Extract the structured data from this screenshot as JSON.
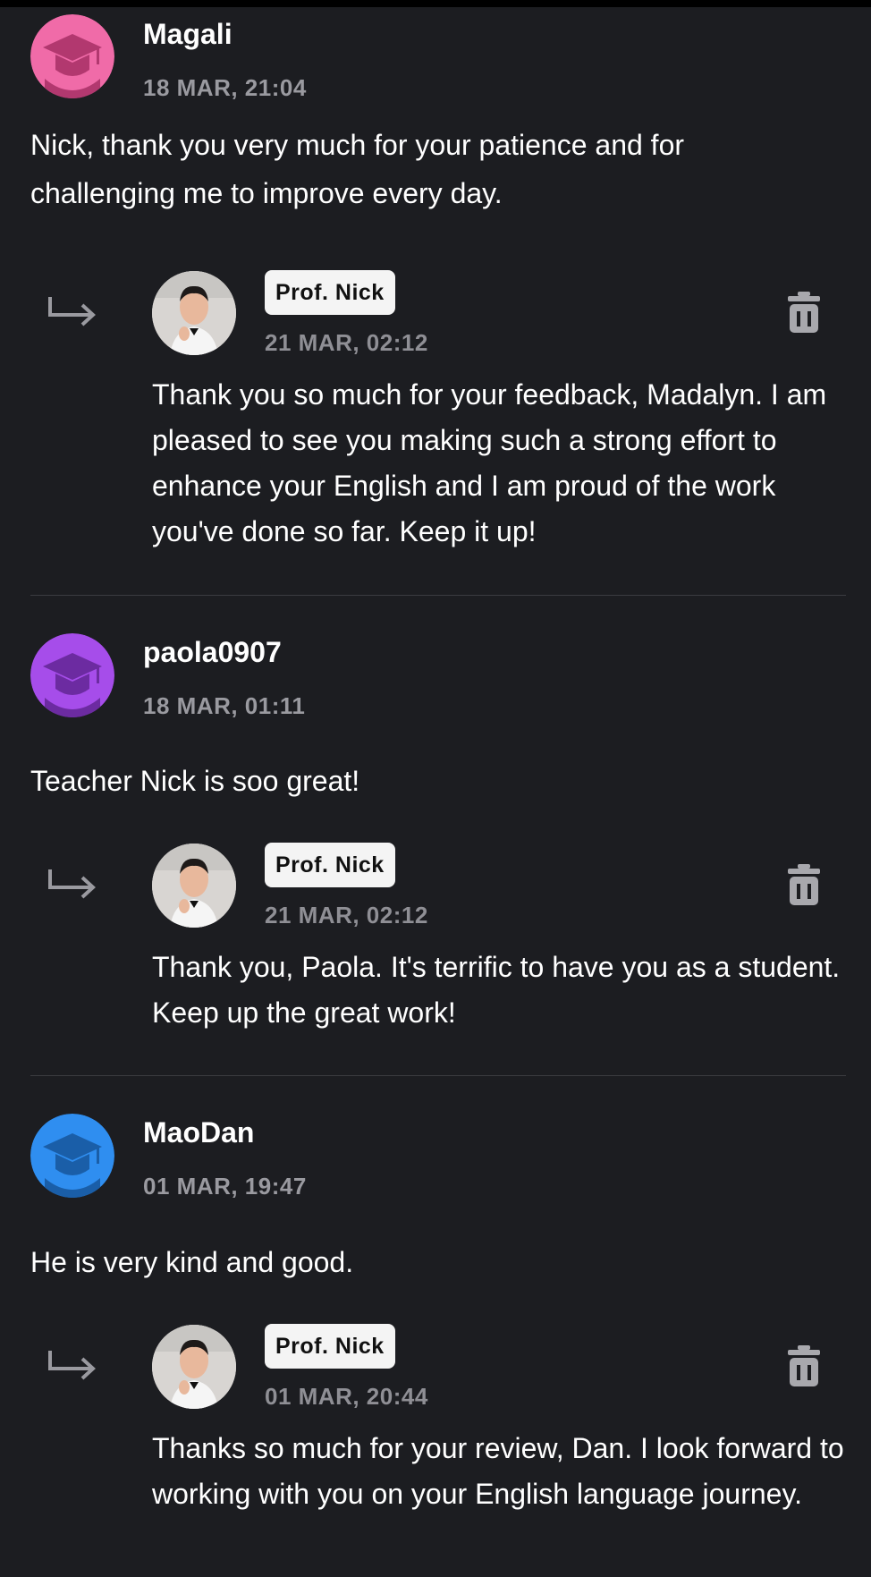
{
  "reviews": [
    {
      "author": "Magali",
      "date": "18 MAR, 21:04",
      "avatar_color": "#f06ba8",
      "avatar_icon": "graduation-cap-icon",
      "comment": "Nick, thank you very much for your patience and for challenging me to improve every day.",
      "reply": {
        "teacher": "Prof. Nick",
        "date": "21 MAR, 02:12",
        "text": "Thank you so much for your feedback, Madalyn. I am pleased to see you making such a strong effort to enhance your English and I am proud of the work you've done so far. Keep it up!"
      }
    },
    {
      "author": "paola0907",
      "date": "18 MAR, 01:11",
      "avatar_color": "#a64dea",
      "avatar_icon": "graduation-cap-icon",
      "comment": "Teacher Nick is soo great!",
      "reply": {
        "teacher": "Prof. Nick",
        "date": "21 MAR, 02:12",
        "text": "Thank you, Paola. It's terrific to have you as a student. Keep up the great work!"
      }
    },
    {
      "author": "MaoDan",
      "date": "01 MAR, 19:47",
      "avatar_color": "#2f8ef0",
      "avatar_icon": "graduation-cap-icon",
      "comment": "He is very kind and good.",
      "reply": {
        "teacher": "Prof. Nick",
        "date": "01 MAR, 20:44",
        "text": "Thanks so much for your review, Dan. I look forward to working with you on your English language journey."
      }
    }
  ],
  "colors": {
    "background": "#1c1d21",
    "date_gray": "#9a9aa0",
    "badge_bg": "#f4f4f4"
  },
  "icons": {
    "reply": "reply-arrow-icon",
    "delete": "trash-icon"
  }
}
